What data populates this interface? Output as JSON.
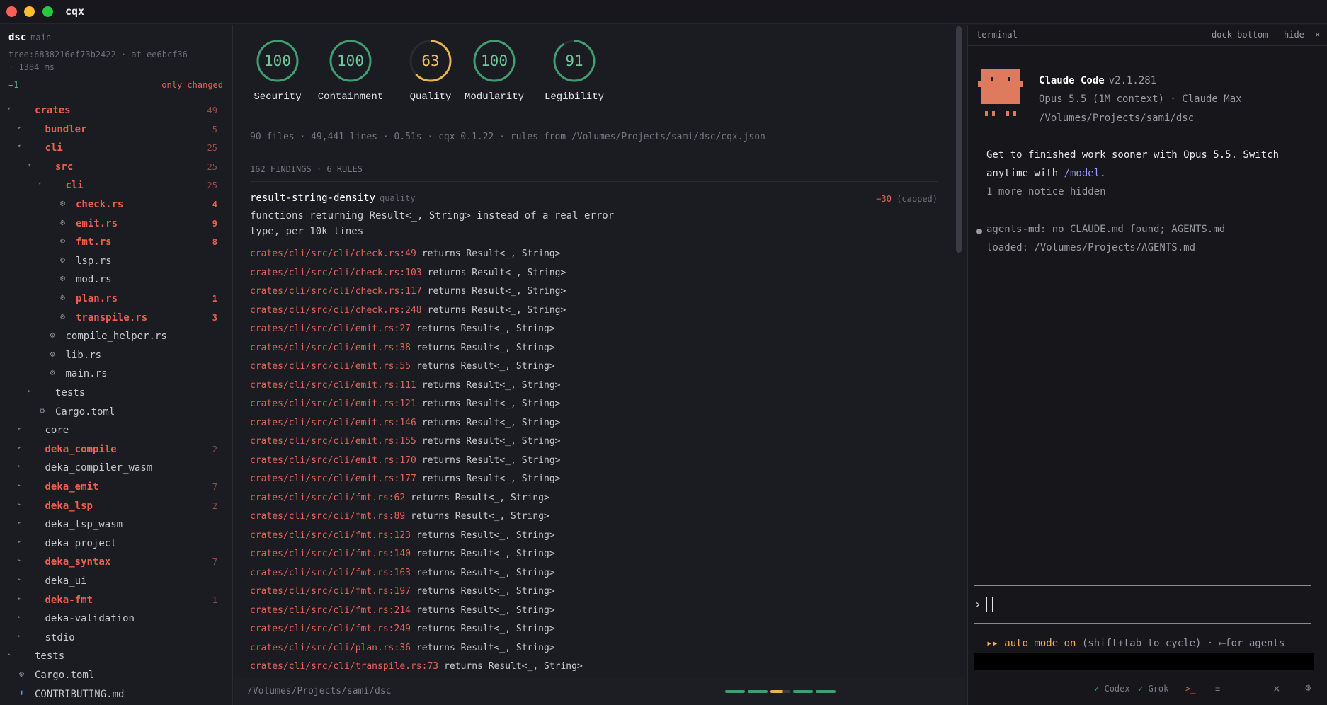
{
  "window": {
    "title": "cqx"
  },
  "repo": {
    "name": "dsc",
    "branch": "main",
    "tree_line": "tree:6838216ef73b2422 · at ee6bcf36",
    "time_line": "· 1384 ms",
    "delta": "+1",
    "filter": "only changed"
  },
  "tree": [
    {
      "label": "crates",
      "count": "49",
      "changed": true,
      "hot": false,
      "indent": 0,
      "caret": "▾",
      "icon": ""
    },
    {
      "label": "bundler",
      "count": "5",
      "changed": true,
      "hot": false,
      "indent": 1,
      "caret": "▸",
      "icon": ""
    },
    {
      "label": "cli",
      "count": "25",
      "changed": true,
      "hot": false,
      "indent": 1,
      "caret": "▾",
      "icon": ""
    },
    {
      "label": "src",
      "count": "25",
      "changed": true,
      "hot": false,
      "indent": 2,
      "caret": "▾",
      "icon": ""
    },
    {
      "label": "cli",
      "count": "25",
      "changed": true,
      "hot": false,
      "indent": 3,
      "caret": "▾",
      "icon": ""
    },
    {
      "label": "check.rs",
      "count": "4",
      "changed": true,
      "hot": true,
      "indent": 4,
      "caret": "",
      "icon": "rust-file-icon"
    },
    {
      "label": "emit.rs",
      "count": "9",
      "changed": true,
      "hot": true,
      "indent": 4,
      "caret": "",
      "icon": "rust-file-icon"
    },
    {
      "label": "fmt.rs",
      "count": "8",
      "changed": true,
      "hot": true,
      "indent": 4,
      "caret": "",
      "icon": "rust-file-icon"
    },
    {
      "label": "lsp.rs",
      "count": "",
      "changed": false,
      "hot": false,
      "indent": 4,
      "caret": "",
      "icon": "rust-file-icon"
    },
    {
      "label": "mod.rs",
      "count": "",
      "changed": false,
      "hot": false,
      "indent": 4,
      "caret": "",
      "icon": "rust-file-icon"
    },
    {
      "label": "plan.rs",
      "count": "1",
      "changed": true,
      "hot": true,
      "indent": 4,
      "caret": "",
      "icon": "rust-file-icon"
    },
    {
      "label": "transpile.rs",
      "count": "3",
      "changed": true,
      "hot": true,
      "indent": 4,
      "caret": "",
      "icon": "rust-file-icon"
    },
    {
      "label": "compile_helper.rs",
      "count": "",
      "changed": false,
      "hot": false,
      "indent": 3,
      "caret": "",
      "icon": "rust-file-icon"
    },
    {
      "label": "lib.rs",
      "count": "",
      "changed": false,
      "hot": false,
      "indent": 3,
      "caret": "",
      "icon": "rust-file-icon"
    },
    {
      "label": "main.rs",
      "count": "",
      "changed": false,
      "hot": false,
      "indent": 3,
      "caret": "",
      "icon": "rust-file-icon"
    },
    {
      "label": "tests",
      "count": "",
      "changed": false,
      "hot": false,
      "indent": 2,
      "caret": "▸",
      "icon": ""
    },
    {
      "label": "Cargo.toml",
      "count": "",
      "changed": false,
      "hot": false,
      "indent": 2,
      "caret": "",
      "icon": "gear-icon"
    },
    {
      "label": "core",
      "count": "",
      "changed": false,
      "hot": false,
      "indent": 1,
      "caret": "▸",
      "icon": ""
    },
    {
      "label": "deka_compile",
      "count": "2",
      "changed": true,
      "hot": false,
      "indent": 1,
      "caret": "▸",
      "icon": ""
    },
    {
      "label": "deka_compiler_wasm",
      "count": "",
      "changed": false,
      "hot": false,
      "indent": 1,
      "caret": "▸",
      "icon": ""
    },
    {
      "label": "deka_emit",
      "count": "7",
      "changed": true,
      "hot": false,
      "indent": 1,
      "caret": "▸",
      "icon": ""
    },
    {
      "label": "deka_lsp",
      "count": "2",
      "changed": true,
      "hot": false,
      "indent": 1,
      "caret": "▸",
      "icon": ""
    },
    {
      "label": "deka_lsp_wasm",
      "count": "",
      "changed": false,
      "hot": false,
      "indent": 1,
      "caret": "▸",
      "icon": ""
    },
    {
      "label": "deka_project",
      "count": "",
      "changed": false,
      "hot": false,
      "indent": 1,
      "caret": "▸",
      "icon": ""
    },
    {
      "label": "deka_syntax",
      "count": "7",
      "changed": true,
      "hot": false,
      "indent": 1,
      "caret": "▸",
      "icon": ""
    },
    {
      "label": "deka_ui",
      "count": "",
      "changed": false,
      "hot": false,
      "indent": 1,
      "caret": "▸",
      "icon": ""
    },
    {
      "label": "deka-fmt",
      "count": "1",
      "changed": true,
      "hot": false,
      "indent": 1,
      "caret": "▸",
      "icon": ""
    },
    {
      "label": "deka-validation",
      "count": "",
      "changed": false,
      "hot": false,
      "indent": 1,
      "caret": "▸",
      "icon": ""
    },
    {
      "label": "stdio",
      "count": "",
      "changed": false,
      "hot": false,
      "indent": 1,
      "caret": "▸",
      "icon": ""
    },
    {
      "label": "tests",
      "count": "",
      "changed": false,
      "hot": false,
      "indent": 0,
      "caret": "▸",
      "icon": ""
    },
    {
      "label": "Cargo.toml",
      "count": "",
      "changed": false,
      "hot": false,
      "indent": 0,
      "caret": "",
      "icon": "gear-icon"
    },
    {
      "label": "CONTRIBUTING.md",
      "count": "",
      "changed": false,
      "hot": false,
      "indent": 0,
      "caret": "",
      "icon": "markdown-icon"
    }
  ],
  "scores": [
    {
      "label": "Security",
      "value": "100",
      "fraction": 1.0,
      "color": "#3f9f70"
    },
    {
      "label": "Containment",
      "value": "100",
      "fraction": 1.0,
      "color": "#3f9f70"
    },
    {
      "label": "Quality",
      "value": "63",
      "fraction": 0.63,
      "color": "#e6b450"
    },
    {
      "label": "Modularity",
      "value": "100",
      "fraction": 1.0,
      "color": "#3f9f70"
    },
    {
      "label": "Legibility",
      "value": "91",
      "fraction": 0.91,
      "color": "#3f9f70"
    }
  ],
  "summary": "90 files · 49,441 lines · 0.51s · cqx 0.1.22 · rules from /Volumes/Projects/sami/dsc/cqx.json",
  "findings_header": "162 FINDINGS · 6 RULES",
  "rule": {
    "name": "result-string-density",
    "category": "quality",
    "penalty": "−30",
    "penalty_note": "(capped)",
    "description_line1": "functions returning Result<_, String> instead of a real error",
    "description_line2": "type, per 10k lines"
  },
  "findings": [
    {
      "loc": "crates/cli/src/cli/check.rs:49",
      "msg": "returns Result<_, String>"
    },
    {
      "loc": "crates/cli/src/cli/check.rs:103",
      "msg": "returns Result<_, String>"
    },
    {
      "loc": "crates/cli/src/cli/check.rs:117",
      "msg": "returns Result<_, String>"
    },
    {
      "loc": "crates/cli/src/cli/check.rs:248",
      "msg": "returns Result<_, String>"
    },
    {
      "loc": "crates/cli/src/cli/emit.rs:27",
      "msg": "returns Result<_, String>"
    },
    {
      "loc": "crates/cli/src/cli/emit.rs:38",
      "msg": "returns Result<_, String>"
    },
    {
      "loc": "crates/cli/src/cli/emit.rs:55",
      "msg": "returns Result<_, String>"
    },
    {
      "loc": "crates/cli/src/cli/emit.rs:111",
      "msg": "returns Result<_, String>"
    },
    {
      "loc": "crates/cli/src/cli/emit.rs:121",
      "msg": "returns Result<_, String>"
    },
    {
      "loc": "crates/cli/src/cli/emit.rs:146",
      "msg": "returns Result<_, String>"
    },
    {
      "loc": "crates/cli/src/cli/emit.rs:155",
      "msg": "returns Result<_, String>"
    },
    {
      "loc": "crates/cli/src/cli/emit.rs:170",
      "msg": "returns Result<_, String>"
    },
    {
      "loc": "crates/cli/src/cli/emit.rs:177",
      "msg": "returns Result<_, String>"
    },
    {
      "loc": "crates/cli/src/cli/fmt.rs:62",
      "msg": "returns Result<_, String>"
    },
    {
      "loc": "crates/cli/src/cli/fmt.rs:89",
      "msg": "returns Result<_, String>"
    },
    {
      "loc": "crates/cli/src/cli/fmt.rs:123",
      "msg": "returns Result<_, String>"
    },
    {
      "loc": "crates/cli/src/cli/fmt.rs:140",
      "msg": "returns Result<_, String>"
    },
    {
      "loc": "crates/cli/src/cli/fmt.rs:163",
      "msg": "returns Result<_, String>"
    },
    {
      "loc": "crates/cli/src/cli/fmt.rs:197",
      "msg": "returns Result<_, String>"
    },
    {
      "loc": "crates/cli/src/cli/fmt.rs:214",
      "msg": "returns Result<_, String>"
    },
    {
      "loc": "crates/cli/src/cli/fmt.rs:249",
      "msg": "returns Result<_, String>"
    },
    {
      "loc": "crates/cli/src/cli/plan.rs:36",
      "msg": "returns Result<_, String>"
    },
    {
      "loc": "crates/cli/src/cli/transpile.rs:73",
      "msg": "returns Result<_, String>"
    }
  ],
  "statusbar": {
    "path": "/Volumes/Projects/sami/dsc",
    "pips": [
      "#3f9f70",
      "#3f9f70",
      "#e6b450",
      "#3f9f70",
      "#3f9f70"
    ]
  },
  "terminal": {
    "title": "terminal",
    "dock": "dock bottom",
    "hide": "hide",
    "close": "×",
    "product": "Claude Code",
    "version": "v2.1.281",
    "model": "Opus 5.5 (1M context) · Claude Max",
    "cwd": "/Volumes/Projects/sami/dsc",
    "notice_line1": "Get to finished work sooner with Opus 5.5. Switch",
    "notice_line2_pre": "anytime with ",
    "notice_line2_link": "/model",
    "notice_line2_post": ".",
    "hidden_notice": "1 more notice hidden",
    "agents_line1": "agents-md: no CLAUDE.md found; AGENTS.md",
    "agents_line2": "loaded: /Volumes/Projects/AGENTS.md",
    "prompt": "›",
    "auto_on": "▸▸ auto mode on",
    "auto_rest": " (shift+tab to cycle) · ⟵for agents",
    "mascot_color": "#e07a5f"
  },
  "footer": {
    "codex_check": "✓",
    "codex": "Codex",
    "grok_check": "✓",
    "grok": "Grok",
    "term_icon": ">_",
    "menu_icon": "≡",
    "close_icon": "×",
    "gear_icon": "⚙"
  }
}
